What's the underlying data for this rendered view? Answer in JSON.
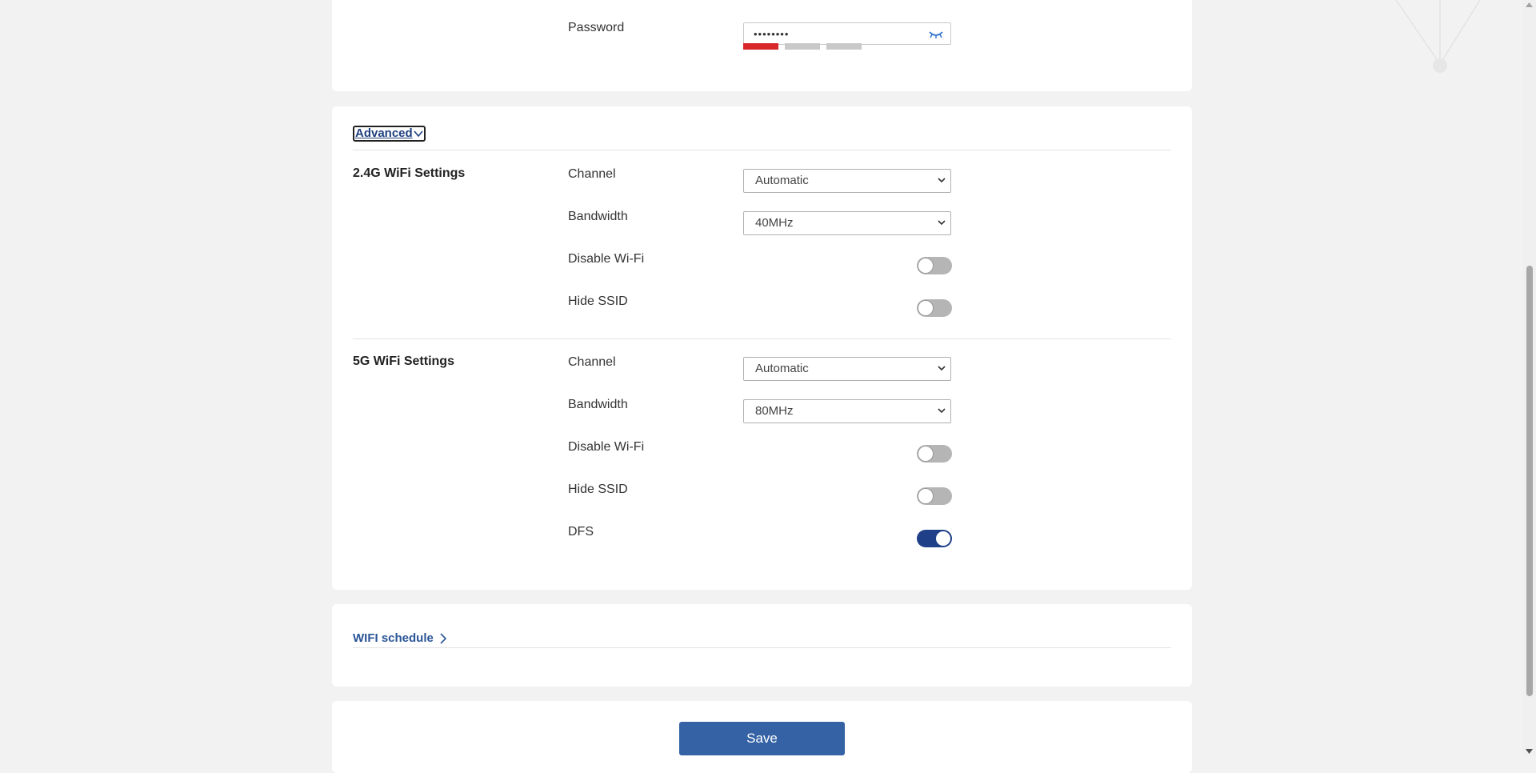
{
  "network": {
    "password_label": "Password",
    "password_value": "••••••••",
    "password_strength_level": 1
  },
  "advanced": {
    "toggle_label": "Advanced",
    "wifi_24g": {
      "title": "2.4G WiFi Settings",
      "channel_label": "Channel",
      "channel_value": "Automatic",
      "bandwidth_label": "Bandwidth",
      "bandwidth_value": "40MHz",
      "disable_wifi_label": "Disable Wi-Fi",
      "disable_wifi_on": false,
      "hide_ssid_label": "Hide SSID",
      "hide_ssid_on": false
    },
    "wifi_5g": {
      "title": "5G WiFi Settings",
      "channel_label": "Channel",
      "channel_value": "Automatic",
      "bandwidth_label": "Bandwidth",
      "bandwidth_value": "80MHz",
      "disable_wifi_label": "Disable Wi-Fi",
      "disable_wifi_on": false,
      "hide_ssid_label": "Hide SSID",
      "hide_ssid_on": false,
      "dfs_label": "DFS",
      "dfs_on": true
    }
  },
  "schedule": {
    "link_label": "WIFI schedule"
  },
  "actions": {
    "save_label": "Save"
  },
  "colors": {
    "accent": "#1f3f88",
    "button": "#3462a4",
    "strength_weak": "#d9262a"
  },
  "icons": {
    "password_visibility": "eye-closed-icon",
    "advanced_expand": "chevron-down-icon",
    "schedule_arrow": "chevron-right-icon",
    "select_caret": "caret-down-icon"
  }
}
